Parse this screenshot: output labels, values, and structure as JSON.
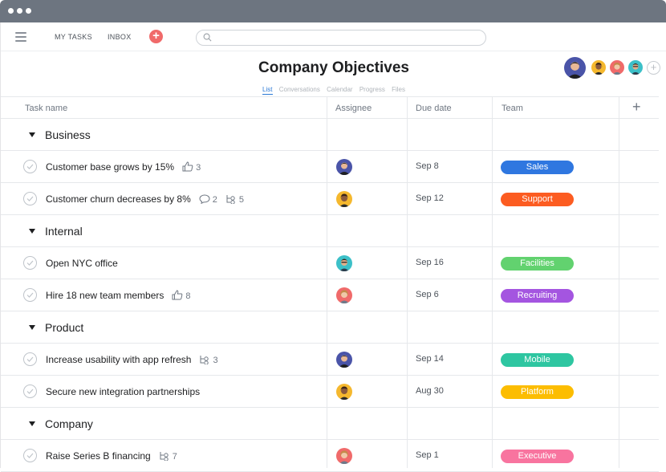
{
  "nav": {
    "my_tasks": "MY TASKS",
    "inbox": "INBOX",
    "add_symbol": "+",
    "search_placeholder": ""
  },
  "project": {
    "title": "Company Objectives",
    "tabs": [
      "List",
      "Conversations",
      "Calendar",
      "Progress",
      "Files"
    ],
    "active_tab": "List",
    "add_member_symbol": "+"
  },
  "columns": {
    "task": "Task name",
    "assignee": "Assignee",
    "due": "Due date",
    "team": "Team",
    "add": "+"
  },
  "sections": [
    {
      "name": "Business",
      "tasks": [
        {
          "name": "Customer base grows by 15%",
          "likes": "3",
          "comments": "",
          "subtasks": "",
          "assignee": "blue",
          "due": "Sep 8",
          "team": "Sales",
          "team_color": "#2f77e0"
        },
        {
          "name": "Customer churn decreases by 8%",
          "likes": "",
          "comments": "2",
          "subtasks": "5",
          "assignee": "yellow",
          "due": "Sep 12",
          "team": "Support",
          "team_color": "#fc5c21"
        }
      ]
    },
    {
      "name": "Internal",
      "tasks": [
        {
          "name": "Open NYC office",
          "likes": "",
          "comments": "",
          "subtasks": "",
          "assignee": "teal",
          "due": "Sep 16",
          "team": "Facilities",
          "team_color": "#62d26f"
        },
        {
          "name": "Hire 18 new team members",
          "likes": "8",
          "comments": "",
          "subtasks": "",
          "assignee": "red",
          "due": "Sep 6",
          "team": "Recruiting",
          "team_color": "#a455e0"
        }
      ]
    },
    {
      "name": "Product",
      "tasks": [
        {
          "name": "Increase usability with app refresh",
          "likes": "",
          "comments": "",
          "subtasks": "3",
          "assignee": "blue",
          "due": "Sep 14",
          "team": "Mobile",
          "team_color": "#2ec6a1"
        },
        {
          "name": "Secure new integration partnerships",
          "likes": "",
          "comments": "",
          "subtasks": "",
          "assignee": "yellow",
          "due": "Aug 30",
          "team": "Platform",
          "team_color": "#fcbd01"
        }
      ]
    },
    {
      "name": "Company",
      "tasks": [
        {
          "name": "Raise Series B financing",
          "likes": "",
          "comments": "",
          "subtasks": "7",
          "assignee": "red",
          "due": "Sep 1",
          "team": "Executive",
          "team_color": "#f8749f"
        }
      ]
    }
  ]
}
